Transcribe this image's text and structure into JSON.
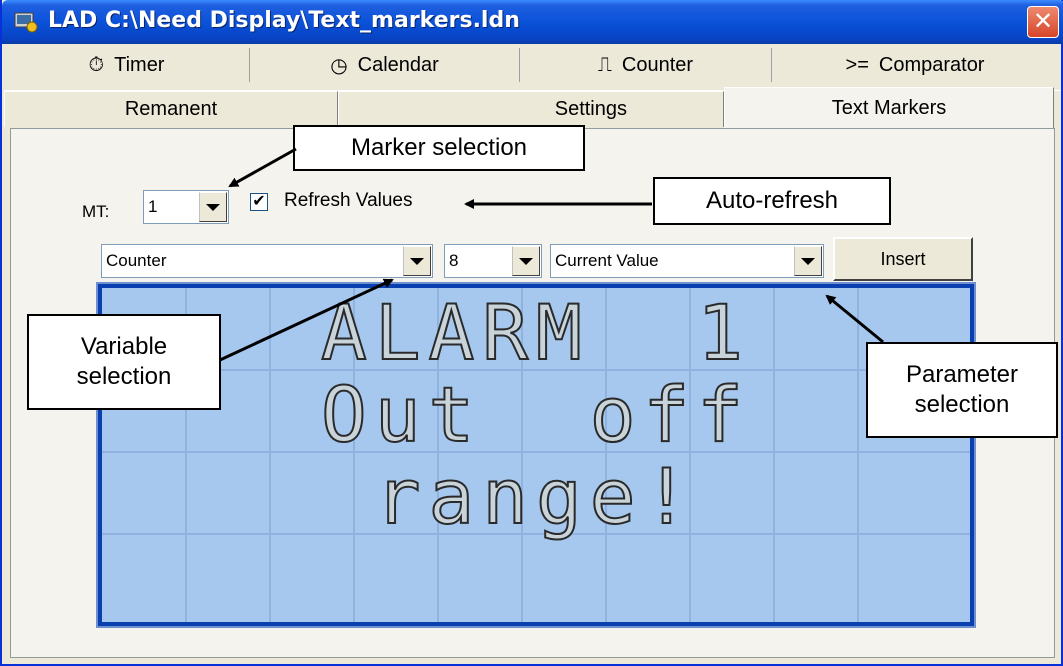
{
  "window": {
    "title": "LAD C:\\Need Display\\Text_markers.ldn",
    "close_symbol": "✕"
  },
  "tabs_row1": [
    {
      "label": "Timer",
      "icon": "⏱"
    },
    {
      "label": "Calendar",
      "icon": "◷"
    },
    {
      "label": "Counter",
      "icon": "⎍"
    },
    {
      "label": "Comparator",
      "icon": ">="
    }
  ],
  "tabs_row2": [
    {
      "label": "Remanent"
    },
    {
      "label": "Settings"
    },
    {
      "label": "Text Markers",
      "active": true
    }
  ],
  "marker": {
    "label": "MT:",
    "value": "1",
    "refresh_checked": true,
    "refresh_label": "Refresh Values"
  },
  "selectors": {
    "variable": "Counter",
    "index": "8",
    "parameter": "Current Value",
    "insert_label": "Insert"
  },
  "lcd": {
    "lines": [
      "ALARM  1",
      "Out  off",
      "range!"
    ],
    "background": "#a6c8ee",
    "border": "#0a3fb0"
  },
  "callouts": {
    "marker_selection": "Marker selection",
    "auto_refresh": "Auto-refresh",
    "variable_selection": "Variable\nselection",
    "parameter_selection": "Parameter\nselection"
  }
}
